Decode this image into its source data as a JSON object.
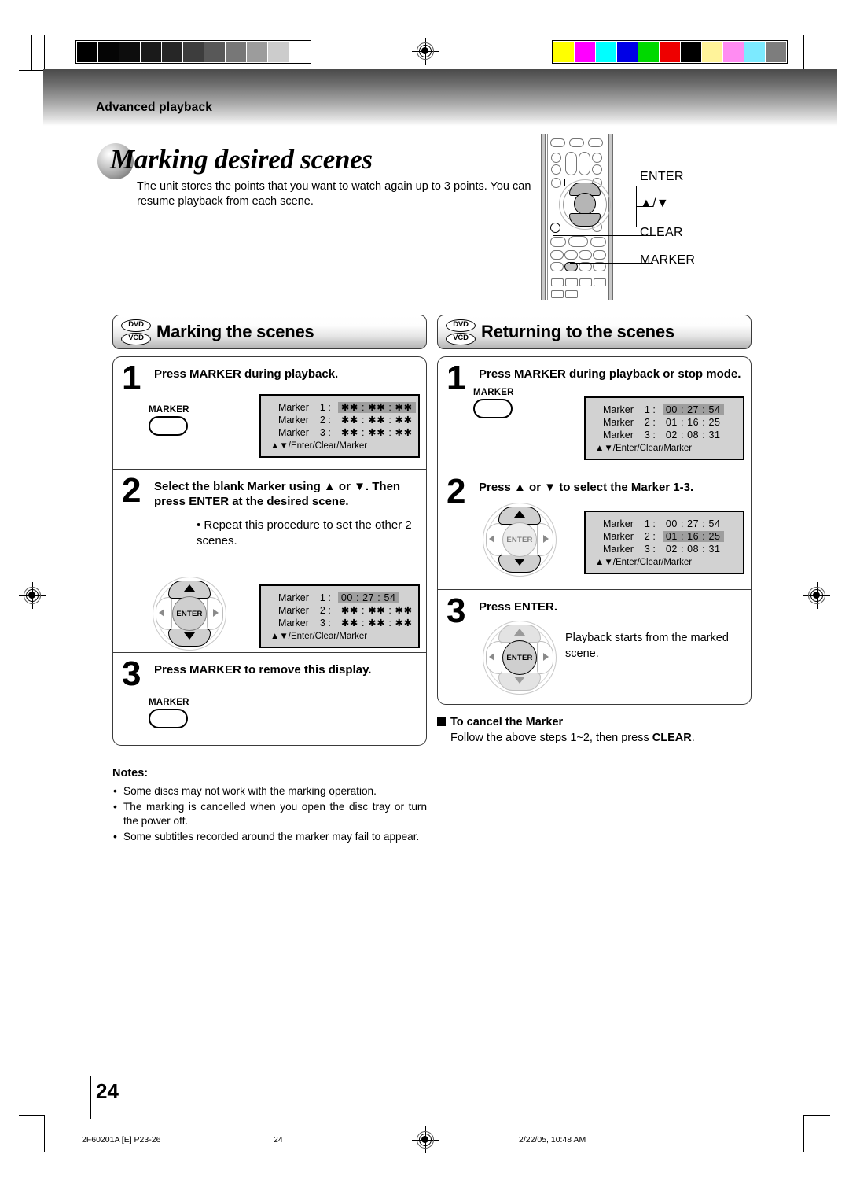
{
  "chapter": {
    "label": "Advanced playback"
  },
  "title": {
    "text": "Marking desired scenes"
  },
  "intro": {
    "text": "The unit stores the points that you want to watch again up to 3 points. You can resume playback from each scene."
  },
  "remote": {
    "callouts": [
      {
        "name": "enter",
        "label": "ENTER"
      },
      {
        "name": "updown",
        "label": "▲/▼"
      },
      {
        "name": "clear",
        "label": "CLEAR"
      },
      {
        "name": "marker",
        "label": "MARKER"
      }
    ]
  },
  "badges": {
    "dvd": "DVD",
    "vcd": "VCD"
  },
  "osd_footer": "▲▼/Enter/Clear/Marker",
  "marker_key_label": "MARKER",
  "enter_key_label": "ENTER",
  "left_section": {
    "title": "Marking the scenes",
    "steps": [
      {
        "num": "1",
        "head": "Press MARKER during playback.",
        "sub": "",
        "osd": {
          "rows": [
            {
              "label": "Marker",
              "index": "1 :",
              "value": "✱✱ : ✱✱ : ✱✱",
              "highlight": true
            },
            {
              "label": "Marker",
              "index": "2 :",
              "value": "✱✱ : ✱✱ : ✱✱",
              "highlight": false
            },
            {
              "label": "Marker",
              "index": "3 :",
              "value": "✱✱ : ✱✱ : ✱✱",
              "highlight": false
            }
          ]
        }
      },
      {
        "num": "2",
        "head": "Select the blank Marker using ▲ or ▼. Then press ENTER at the desired scene.",
        "sub": "• Repeat this procedure to set the other 2 scenes.",
        "osd": {
          "rows": [
            {
              "label": "Marker",
              "index": "1 :",
              "value": "00 : 27 : 54",
              "highlight": true
            },
            {
              "label": "Marker",
              "index": "2 :",
              "value": "✱✱ : ✱✱ : ✱✱",
              "highlight": false
            },
            {
              "label": "Marker",
              "index": "3 :",
              "value": "✱✱ : ✱✱ : ✱✱",
              "highlight": false
            }
          ]
        }
      },
      {
        "num": "3",
        "head": "Press MARKER to remove this display.",
        "sub": ""
      }
    ]
  },
  "right_section": {
    "title": "Returning to the scenes",
    "steps": [
      {
        "num": "1",
        "head": "Press MARKER during playback or stop mode.",
        "osd": {
          "rows": [
            {
              "label": "Marker",
              "index": "1 :",
              "value": "00 : 27 : 54",
              "highlight": true
            },
            {
              "label": "Marker",
              "index": "2 :",
              "value": "01 : 16 : 25",
              "highlight": false
            },
            {
              "label": "Marker",
              "index": "3 :",
              "value": "02 : 08 : 31",
              "highlight": false
            }
          ]
        }
      },
      {
        "num": "2",
        "head": "Press ▲ or ▼ to select the Marker 1-3.",
        "osd": {
          "rows": [
            {
              "label": "Marker",
              "index": "1 :",
              "value": "00 : 27 : 54",
              "highlight": false
            },
            {
              "label": "Marker",
              "index": "2 :",
              "value": "01 : 16 : 25",
              "highlight": true
            },
            {
              "label": "Marker",
              "index": "3 :",
              "value": "02 : 08 : 31",
              "highlight": false
            }
          ]
        }
      },
      {
        "num": "3",
        "head": "Press ENTER.",
        "sub": "Playback starts from the marked scene."
      }
    ],
    "cancel": {
      "title": "To cancel the Marker",
      "text_before": "Follow the above steps 1~2, then press ",
      "text_bold": "CLEAR",
      "text_after": "."
    }
  },
  "notes": {
    "title": "Notes:",
    "items": [
      "Some discs may not work with the marking operation.",
      "The marking is cancelled when you open the disc tray or turn the power off.",
      "Some subtitles recorded around the marker may fail to appear."
    ]
  },
  "footer": {
    "folio": "24",
    "file": "2F60201A [E] P23-26",
    "page": "24",
    "date": "2/22/05, 10:48 AM"
  },
  "calibration": {
    "gray_swatches": [
      "#000000",
      "#050505",
      "#0d0d0d",
      "#1a1a1a",
      "#262626",
      "#3d3d3d",
      "#585858",
      "#777777",
      "#9c9c9c",
      "#cccccc",
      "#ffffff"
    ],
    "color_swatches": [
      "#ffff00",
      "#ff00ff",
      "#00ffff",
      "#0000e6",
      "#00d900",
      "#ee0000",
      "#000000",
      "#fff39a",
      "#ff8cf2",
      "#7ceaff",
      "#7d7d7d"
    ]
  }
}
